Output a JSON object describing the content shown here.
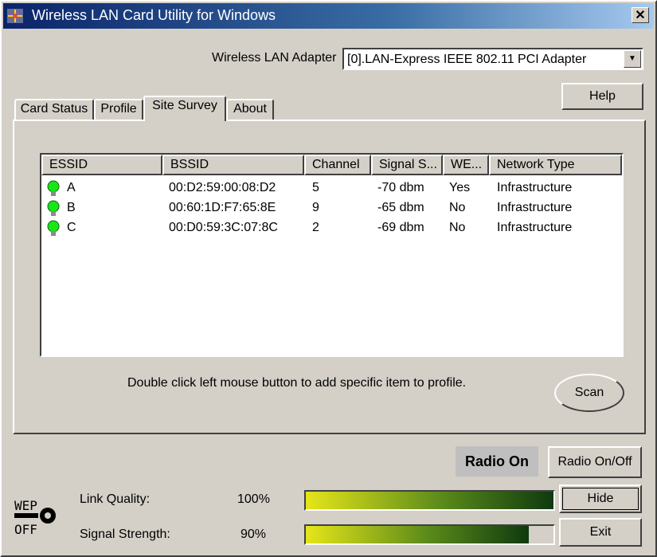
{
  "window": {
    "title": "Wireless LAN Card Utility for Windows",
    "close_glyph": "✕"
  },
  "adapter": {
    "label": "Wireless LAN Adapter",
    "value": "[0].LAN-Express IEEE 802.11 PCI Adapter"
  },
  "help_label": "Help",
  "tabs": [
    {
      "label": "Card Status"
    },
    {
      "label": "Profile"
    },
    {
      "label": "Site Survey",
      "active": true
    },
    {
      "label": "About"
    }
  ],
  "survey": {
    "columns": [
      "ESSID",
      "BSSID",
      "Channel",
      "Signal S...",
      "WE...",
      "Network Type"
    ],
    "rows": [
      {
        "essid": "A",
        "bssid": "00:D2:59:00:08:D2",
        "channel": "5",
        "signal": "-70 dbm",
        "wep": "Yes",
        "type": "Infrastructure"
      },
      {
        "essid": "B",
        "bssid": "00:60:1D:F7:65:8E",
        "channel": "9",
        "signal": "-65 dbm",
        "wep": "No",
        "type": "Infrastructure"
      },
      {
        "essid": "C",
        "bssid": "00:D0:59:3C:07:8C",
        "channel": "2",
        "signal": "-69 dbm",
        "wep": "No",
        "type": "Infrastructure"
      }
    ],
    "hint": "Double click left mouse button to add specific item to profile.",
    "scan_label": "Scan"
  },
  "radio": {
    "status": "Radio On",
    "toggle_label": "Radio On/Off"
  },
  "status": {
    "link_quality": {
      "label": "Link Quality:",
      "value": "100%",
      "percent": 100
    },
    "signal_strength": {
      "label": "Signal Strength:",
      "value": "90%",
      "percent": 90
    },
    "wep_top": "WEP",
    "wep_bottom": "OFF"
  },
  "hide_label": "Hide",
  "exit_label": "Exit",
  "colors": {
    "title_start": "#0a246a",
    "title_end": "#a6caf0",
    "bulb": "#19e619",
    "bar_start": "#e6e619",
    "bar_end": "#0f3a0f"
  }
}
